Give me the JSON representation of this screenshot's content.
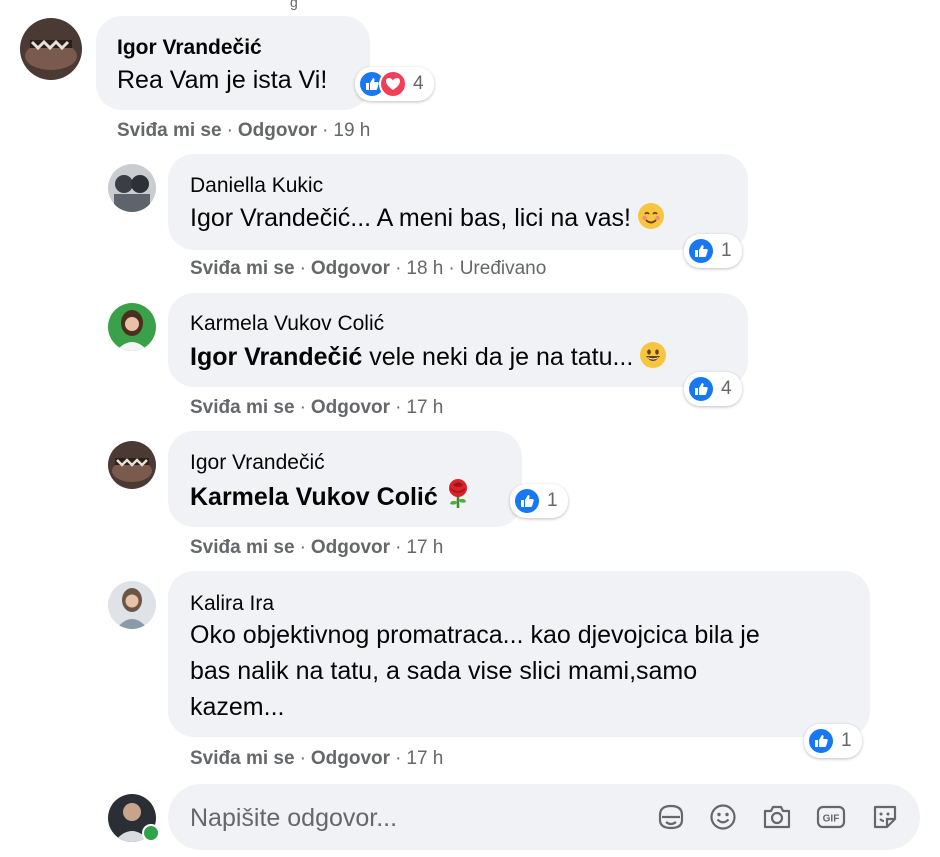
{
  "top_remnant": "g",
  "comments": [
    {
      "author": "Igor Vrandečić",
      "text": "Rea Vam je ista Vi!",
      "reactions": {
        "count": "4",
        "types": [
          "like",
          "love"
        ]
      },
      "actions": {
        "like": "Sviđa mi se",
        "reply": "Odgovor",
        "time": "19 h"
      }
    },
    {
      "author": "Daniella Kukic",
      "text": "Igor Vrandečić... A meni bas, lici na vas!",
      "emoji": "smiling-face-icon",
      "reactions": {
        "count": "1",
        "types": [
          "like"
        ]
      },
      "actions": {
        "like": "Sviđa mi se",
        "reply": "Odgovor",
        "time": "18 h",
        "edited": "Uređivano"
      }
    },
    {
      "author": "Karmela Vukov Colić",
      "mention": "Igor Vrandečić",
      "text": " vele neki da je na tatu...",
      "emoji": "grinning-face-icon",
      "reactions": {
        "count": "4",
        "types": [
          "like"
        ]
      },
      "actions": {
        "like": "Sviđa mi se",
        "reply": "Odgovor",
        "time": "17 h"
      }
    },
    {
      "author": "Igor Vrandečić",
      "mention": "Karmela Vukov Colić",
      "emoji": "rose-icon",
      "reactions": {
        "count": "1",
        "types": [
          "like"
        ]
      },
      "actions": {
        "like": "Sviđa mi se",
        "reply": "Odgovor",
        "time": "17 h"
      }
    },
    {
      "author": "Kalira Ira",
      "lines": [
        "Oko objektivnog promatraca... kao djevojcica bila je",
        "bas nalik na tatu, a sada vise slici mami,samo",
        "kazem..."
      ],
      "reactions": {
        "count": "1",
        "types": [
          "like"
        ]
      },
      "actions": {
        "like": "Sviđa mi se",
        "reply": "Odgovor",
        "time": "17 h"
      }
    }
  ],
  "composer": {
    "placeholder": "Napišite odgovor...",
    "icons": [
      "sticker-face-icon",
      "emoji-icon",
      "camera-icon",
      "gif-icon",
      "sticker-icon"
    ]
  },
  "colors": {
    "like": "#1877f2",
    "love": "#f33e58",
    "bubble": "#f0f2f5",
    "secondary_text": "#65676b",
    "online": "#31a24c"
  }
}
